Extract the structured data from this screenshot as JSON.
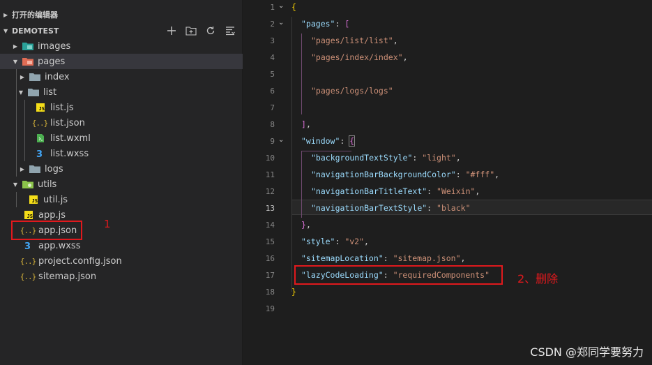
{
  "explorer": {
    "open_editors_label": "打开的编辑器",
    "project_label": "DEMOTEST",
    "header_icons": [
      "new-file-icon",
      "new-folder-icon",
      "refresh-icon",
      "collapse-all-icon"
    ],
    "items": [
      {
        "label": "images",
        "type": "folder",
        "icon": "images-folder-icon",
        "expanded": false
      },
      {
        "label": "pages",
        "type": "folder",
        "icon": "pages-folder-icon",
        "expanded": true
      },
      {
        "label": "index",
        "type": "folder",
        "icon": "folder-icon",
        "expanded": false
      },
      {
        "label": "list",
        "type": "folder",
        "icon": "folder-icon",
        "expanded": true
      },
      {
        "label": "list.js",
        "type": "file",
        "icon": "js-file-icon"
      },
      {
        "label": "list.json",
        "type": "file",
        "icon": "json-file-icon"
      },
      {
        "label": "list.wxml",
        "type": "file",
        "icon": "wxml-file-icon"
      },
      {
        "label": "list.wxss",
        "type": "file",
        "icon": "css-file-icon"
      },
      {
        "label": "logs",
        "type": "folder",
        "icon": "folder-icon",
        "expanded": false
      },
      {
        "label": "utils",
        "type": "folder",
        "icon": "utils-folder-icon",
        "expanded": true
      },
      {
        "label": "util.js",
        "type": "file",
        "icon": "js-file-icon"
      },
      {
        "label": "app.js",
        "type": "file",
        "icon": "js-file-icon"
      },
      {
        "label": "app.json",
        "type": "file",
        "icon": "json-file-icon"
      },
      {
        "label": "app.wxss",
        "type": "file",
        "icon": "css-file-icon"
      },
      {
        "label": "project.config.json",
        "type": "file",
        "icon": "json-file-icon"
      },
      {
        "label": "sitemap.json",
        "type": "file",
        "icon": "json-file-icon"
      }
    ]
  },
  "annotations": {
    "one": "1",
    "two": "2、删除"
  },
  "editor": {
    "active_line": "13",
    "line_numbers": [
      "1",
      "2",
      "3",
      "4",
      "5",
      "6",
      "7",
      "8",
      "9",
      "10",
      "11",
      "12",
      "13",
      "14",
      "15",
      "16",
      "17",
      "18",
      "19"
    ],
    "lines": {
      "l1_brace": "{",
      "l2_key": "\"pages\"",
      "l2_colon": ": ",
      "l2_bracket": "[",
      "l3_str": "\"pages/list/list\"",
      "l3_comma": ",",
      "l4_str": "\"pages/index/index\"",
      "l4_comma": ",",
      "l6_str": "\"pages/logs/logs\"",
      "l8_bracket": "]",
      "l8_comma": ",",
      "l9_key": "\"window\"",
      "l9_colon": ": ",
      "l9_brace": "{",
      "l10_key": "\"backgroundTextStyle\"",
      "l10_colon": ": ",
      "l10_val": "\"light\"",
      "l10_comma": ",",
      "l11_key": "\"navigationBarBackgroundColor\"",
      "l11_colon": ": ",
      "l11_val": "\"#fff\"",
      "l11_comma": ",",
      "l12_key": "\"navigationBarTitleText\"",
      "l12_colon": ": ",
      "l12_val": "\"Weixin\"",
      "l12_comma": ",",
      "l13_key": "\"navigationBarTextStyle\"",
      "l13_colon": ": ",
      "l13_val": "\"black\"",
      "l14_brace": "}",
      "l14_comma": ",",
      "l15_key": "\"style\"",
      "l15_colon": ": ",
      "l15_val": "\"v2\"",
      "l15_comma": ",",
      "l16_key": "\"sitemapLocation\"",
      "l16_colon": ": ",
      "l16_val": "\"sitemap.json\"",
      "l16_comma": ",",
      "l17_key": "\"lazyCodeLoading\"",
      "l17_colon": ": ",
      "l17_val": "\"requiredComponents\"",
      "l18_brace": "}"
    }
  },
  "watermark": "CSDN @郑同学要努力",
  "colors": {
    "annotation_red": "#e0191d",
    "json_key": "#9cdcfe",
    "json_string": "#ce9178",
    "bracket_gold": "#ffd700",
    "bracket_purple": "#da70d6",
    "bracket_blue": "#179fff"
  }
}
